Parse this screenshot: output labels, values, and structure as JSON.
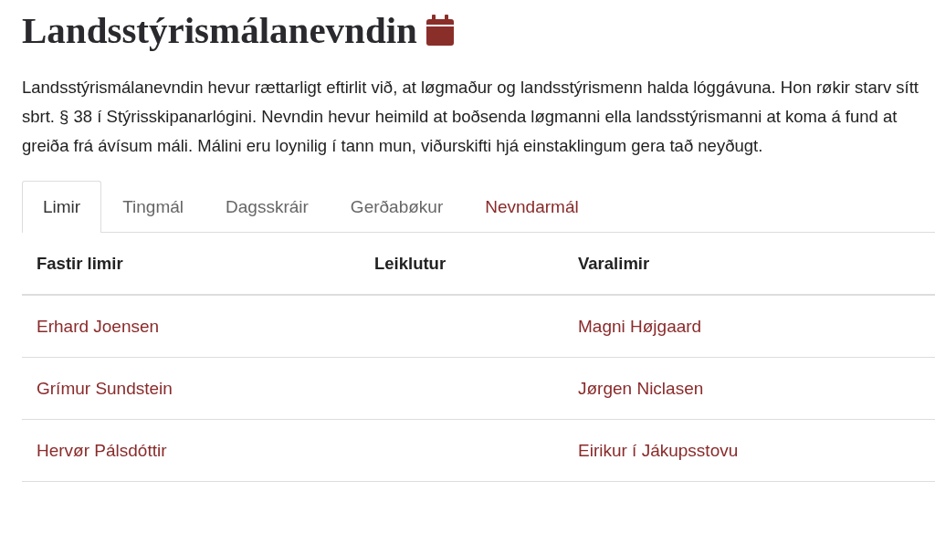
{
  "title": "Landsstýrismálanevndin",
  "description": "Landsstýrismálanevndin hevur rættarligt eftirlit við, at løgmaður og landsstýrismenn halda lóggávuna. Hon røkir starv sítt sbrt. § 38 í Stýrisskipanarlógini. Nevndin hevur heimild at boðsenda løgmanni ella landsstýrismanni at koma á fund at greiða frá ávísum máli. Málini eru loynilig í tann mun, viðurskifti hjá einstaklingum gera tað neyðugt.",
  "tabs": [
    {
      "label": "Limir",
      "selected": true,
      "disabled": false
    },
    {
      "label": "Tingmál",
      "selected": false,
      "disabled": true
    },
    {
      "label": "Dagsskráir",
      "selected": false,
      "disabled": true
    },
    {
      "label": "Gerðabøkur",
      "selected": false,
      "disabled": true
    },
    {
      "label": "Nevndarmál",
      "selected": false,
      "disabled": false
    }
  ],
  "table": {
    "columns": [
      "Fastir limir",
      "Leiklutur",
      "Varalimir"
    ],
    "rows": [
      {
        "fastir_limir": "Erhard Joensen",
        "varalimir": "Magni Højgaard"
      },
      {
        "fastir_limir": "Grímur Sundstein",
        "varalimir": "Jørgen Niclasen"
      },
      {
        "fastir_limir": "Hervør Pálsdóttir",
        "varalimir": "Eirikur í Jákupsstovu"
      }
    ]
  }
}
